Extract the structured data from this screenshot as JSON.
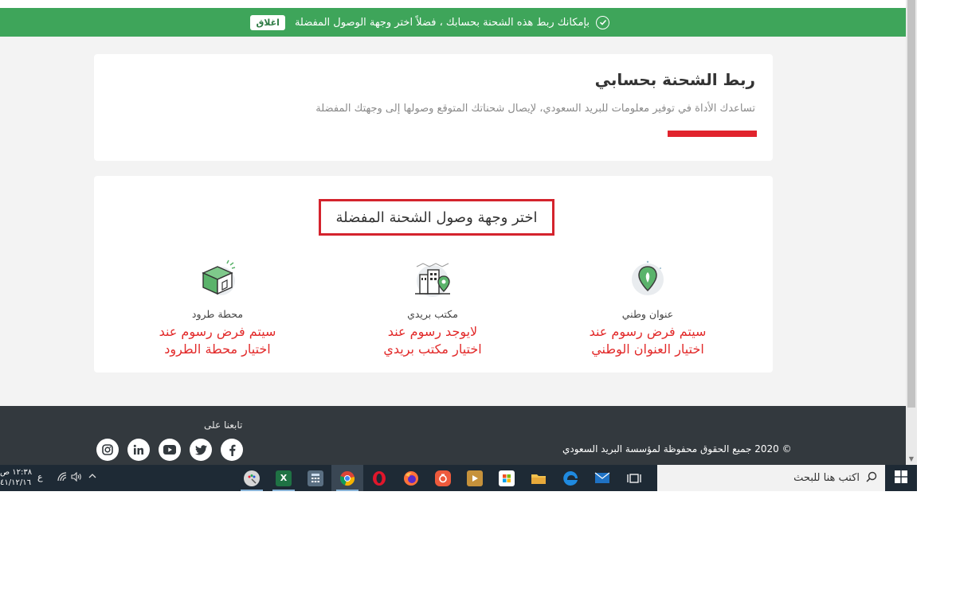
{
  "banner": {
    "message": "بإمكانك ربط هذه الشحنة بحسابك ، فضلاً اختر وجهة الوصول المفضلة",
    "close_label": "اغلاق",
    "color": "#3ea55a"
  },
  "link_card": {
    "title": "ربط الشحنة بحسابي",
    "description": "تساعدك الأداة في توفير معلومات للبريد السعودي، لإيصال شحناتك المتوقع وصولها إلى وجهتك المفضلة",
    "accent_color": "#e1242d"
  },
  "destination_card": {
    "heading": "اختر وجهة وصول الشحنة المفضلة",
    "options": [
      {
        "label": "عنوان وطني",
        "note_line1": "سيتم فرض رسوم عند",
        "note_line2": "اختيار العنوان الوطني",
        "icon": "map-pin-icon"
      },
      {
        "label": "مكتب بريدي",
        "note_line1": "لايوجد رسوم عند",
        "note_line2": "اختيار مكتب بريدي",
        "icon": "post-office-icon"
      },
      {
        "label": "محطة طرود",
        "note_line1": "سيتم فرض رسوم عند",
        "note_line2": "اختيار محطة الطرود",
        "icon": "parcel-box-icon"
      }
    ]
  },
  "footer": {
    "follow_label": "تابعنا على",
    "copyright": "© 2020 جميع الحقوق محفوظة لمؤسسة البريد السعودي",
    "socials": [
      "facebook-icon",
      "twitter-icon",
      "youtube-icon",
      "linkedin-icon",
      "instagram-icon"
    ]
  },
  "taskbar": {
    "search_placeholder": "اكتب هنا للبحث",
    "clock_time": "١٢:٣٨ ص",
    "clock_date": "٤١/١٢/١٦",
    "language": "ع",
    "apps": [
      "task-view-icon",
      "mail-icon",
      "edge-icon",
      "file-explorer-icon",
      "store-icon",
      "media-player-icon",
      "camera-app-icon",
      "firefox-icon",
      "opera-icon",
      "chrome-icon",
      "calculator-icon",
      "excel-icon",
      "paint-icon"
    ]
  }
}
